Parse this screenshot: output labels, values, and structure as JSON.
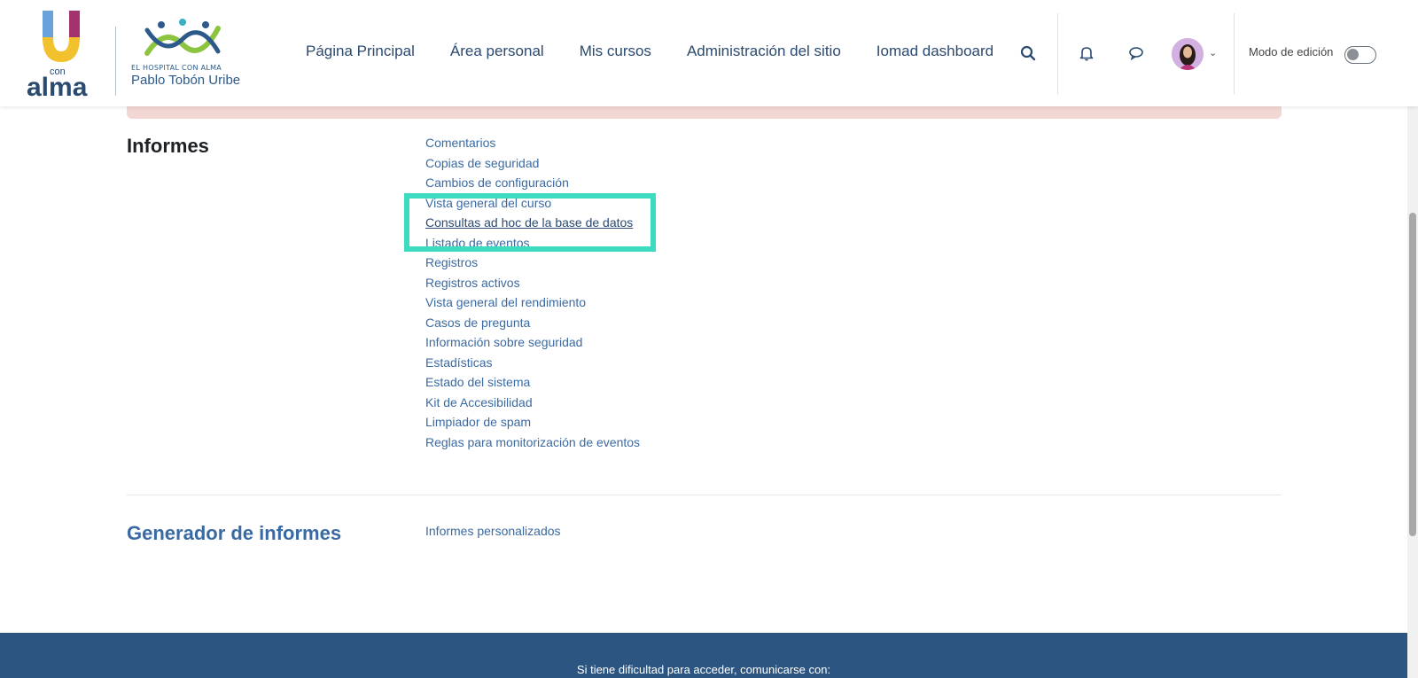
{
  "header": {
    "logo_u_text": "con alma",
    "logo_hospital_small": "EL HOSPITAL CON ALMA",
    "logo_hospital_name": "Pablo Tobón Uribe",
    "nav": [
      "Página Principal",
      "Área personal",
      "Mis cursos",
      "Administración del sitio",
      "Iomad dashboard"
    ],
    "edit_mode_label": "Modo de edición",
    "edit_mode_on": false,
    "icons": [
      "search-icon",
      "bell-icon",
      "chat-icon",
      "avatar",
      "chevron-down-icon"
    ]
  },
  "sections": [
    {
      "title": "Informes",
      "title_color": "#1d2125",
      "links": [
        "Comentarios",
        "Copias de seguridad",
        "Cambios de configuración",
        "Vista general del curso",
        "Consultas ad hoc de la base de datos",
        "Listado de eventos",
        "Registros",
        "Registros activos",
        "Vista general del rendimiento",
        "Casos de pregunta",
        "Información sobre seguridad",
        "Estadísticas",
        "Estado del sistema",
        "Kit de Accesibilidad",
        "Limpiador de spam",
        "Reglas para monitorización de eventos"
      ],
      "highlighted": "Consultas ad hoc de la base de datos"
    },
    {
      "title": "Generador de informes",
      "title_color": "#3a6aa3",
      "links": [
        "Informes personalizados"
      ]
    }
  ],
  "footer": {
    "text": "Si tiene dificultad para acceder, comunicarse con:"
  },
  "colors": {
    "nav_text": "#2b4a70",
    "link": "#3a6aa3",
    "highlight": "#3ddbc0",
    "footer_bg": "#2c5581",
    "alert_bg": "#f3d7d5"
  }
}
